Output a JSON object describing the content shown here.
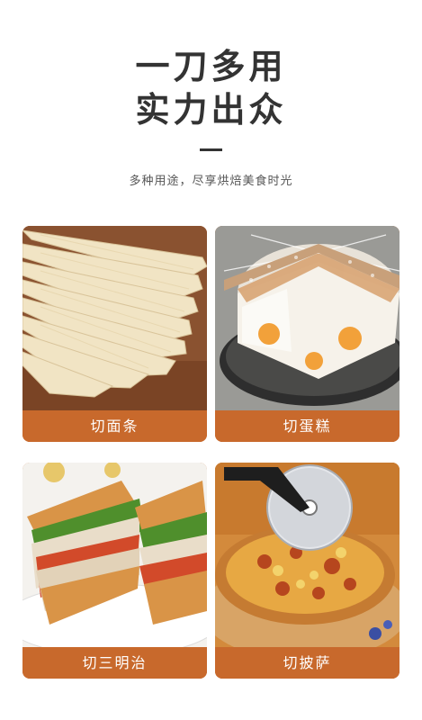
{
  "header": {
    "title_line1": "一刀多用",
    "title_line2": "实力出众",
    "subtitle": "多种用途，尽享烘焙美食时光"
  },
  "cards": [
    {
      "label": "切面条",
      "icon": "noodles-photo"
    },
    {
      "label": "切蛋糕",
      "icon": "cake-photo"
    },
    {
      "label": "切三明治",
      "icon": "sandwich-photo"
    },
    {
      "label": "切披萨",
      "icon": "pizza-photo"
    }
  ],
  "colors": {
    "caption_bg": "#c8692c",
    "title_text": "#333333"
  }
}
